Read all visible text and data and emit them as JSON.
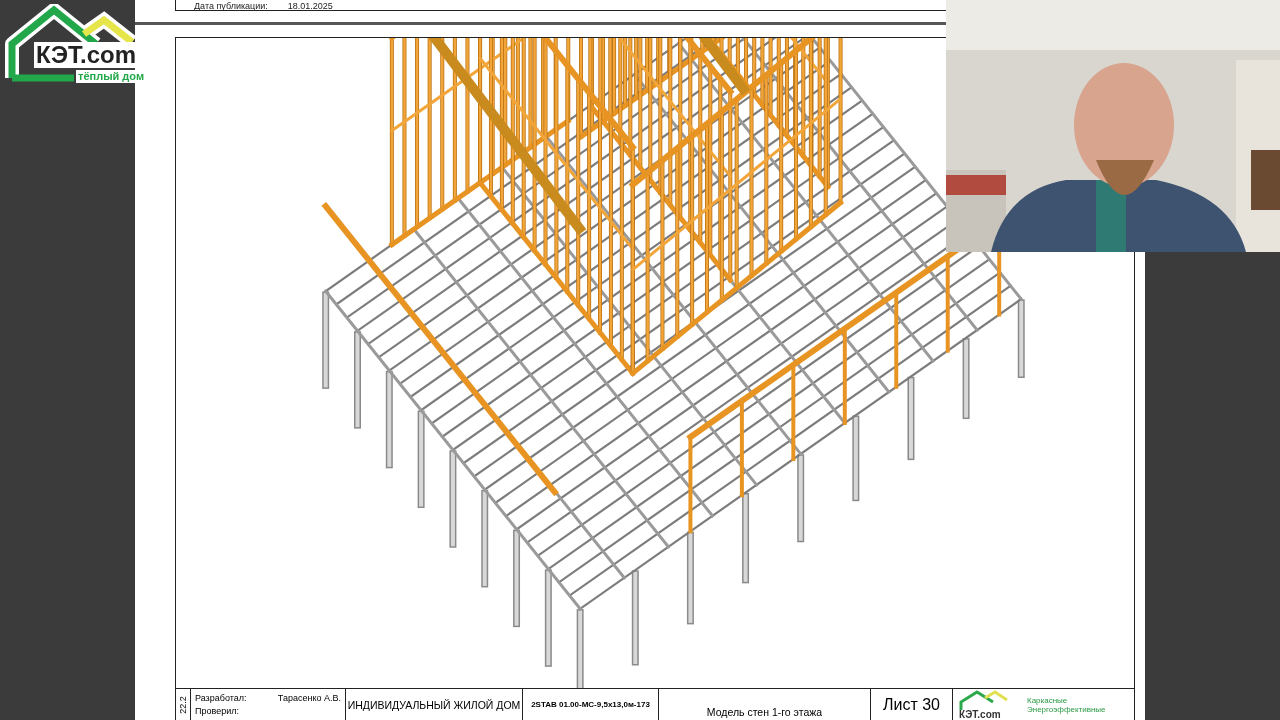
{
  "logo": {
    "name": "КЭТ.com",
    "tagline": "тёплый дом"
  },
  "sheet": {
    "header": {
      "label": "Дата публикации:",
      "date": "18.01.2025"
    },
    "title_block": {
      "revision": "22.2",
      "developed_label": "Разработал:",
      "developed_by": "Тарасенко А.В.",
      "checked_label": "Проверил:",
      "project": "ИНДИВИДУАЛЬНЫЙ ЖИЛОЙ ДОМ",
      "code": "2STAB 01.00-МС-9,5х13,0м-173",
      "sheet_title": "Модель стен 1-го этажа",
      "sheet_number": "Лист 30",
      "company_logo": "КЭТ.com",
      "company_lines": [
        "Каркасные",
        "Энергоэффективные"
      ]
    }
  }
}
